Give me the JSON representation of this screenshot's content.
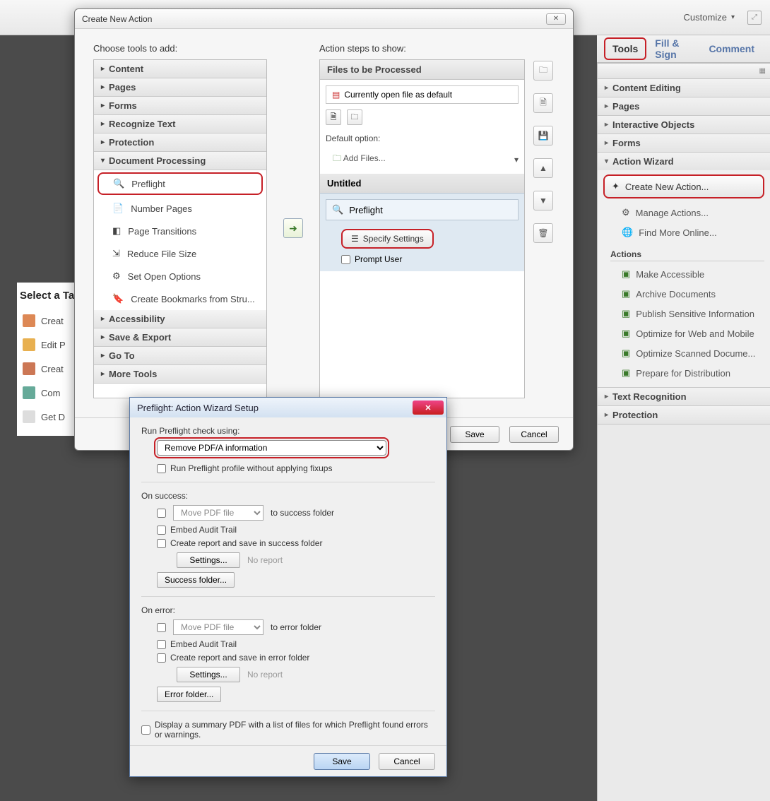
{
  "top": {
    "customize": "Customize"
  },
  "tabs": {
    "tools": "Tools",
    "fill_sign": "Fill & Sign",
    "comment": "Comment"
  },
  "right_panel": {
    "content_editing": "Content Editing",
    "pages": "Pages",
    "interactive_objects": "Interactive Objects",
    "forms": "Forms",
    "action_wizard": "Action Wizard",
    "create_new_action": "Create New Action...",
    "manage_actions": "Manage Actions...",
    "find_more_online": "Find More Online...",
    "actions_label": "Actions",
    "actions": [
      "Make Accessible",
      "Archive Documents",
      "Publish Sensitive Information",
      "Optimize for Web and Mobile",
      "Optimize Scanned Docume...",
      "Prepare for Distribution"
    ],
    "text_recognition": "Text Recognition",
    "protection": "Protection"
  },
  "bg_tasks": {
    "title": "Select a Ta",
    "items": [
      "Creat",
      "Edit P",
      "Creat",
      "Com",
      "Get D"
    ]
  },
  "dialog": {
    "title": "Create New Action",
    "choose_label": "Choose tools to add:",
    "steps_label": "Action steps to show:",
    "categories": {
      "content": "Content",
      "pages": "Pages",
      "forms": "Forms",
      "recognize_text": "Recognize Text",
      "protection": "Protection",
      "document_processing": "Document Processing",
      "accessibility": "Accessibility",
      "save_export": "Save & Export",
      "go_to": "Go To",
      "more_tools": "More Tools"
    },
    "doc_proc_items": [
      "Preflight",
      "Number Pages",
      "Page Transitions",
      "Reduce File Size",
      "Set Open Options",
      "Create Bookmarks from Stru..."
    ],
    "files_header": "Files to be Processed",
    "current_file": "Currently open file as default",
    "default_option": "Default option:",
    "add_files": "Add Files...",
    "untitled": "Untitled",
    "preflight_step": "Preflight",
    "specify_settings": "Specify Settings",
    "prompt_user": "Prompt User",
    "save": "Save",
    "cancel": "Cancel"
  },
  "pf": {
    "title": "Preflight: Action Wizard Setup",
    "run_label": "Run Preflight check using:",
    "profile": "Remove PDF/A information",
    "without_fixups": "Run Preflight profile without applying fixups",
    "on_success": "On success:",
    "move_pdf": "Move PDF file",
    "to_success": "to success folder",
    "embed_audit": "Embed Audit Trail",
    "create_report_success": "Create report and save in success folder",
    "settings": "Settings...",
    "no_report": "No report",
    "success_folder": "Success folder...",
    "on_error": "On error:",
    "to_error": "to error folder",
    "create_report_error": "Create report and save in error folder",
    "error_folder": "Error folder...",
    "summary": "Display a summary PDF with a list of files for which Preflight found errors or warnings.",
    "save": "Save",
    "cancel": "Cancel"
  }
}
